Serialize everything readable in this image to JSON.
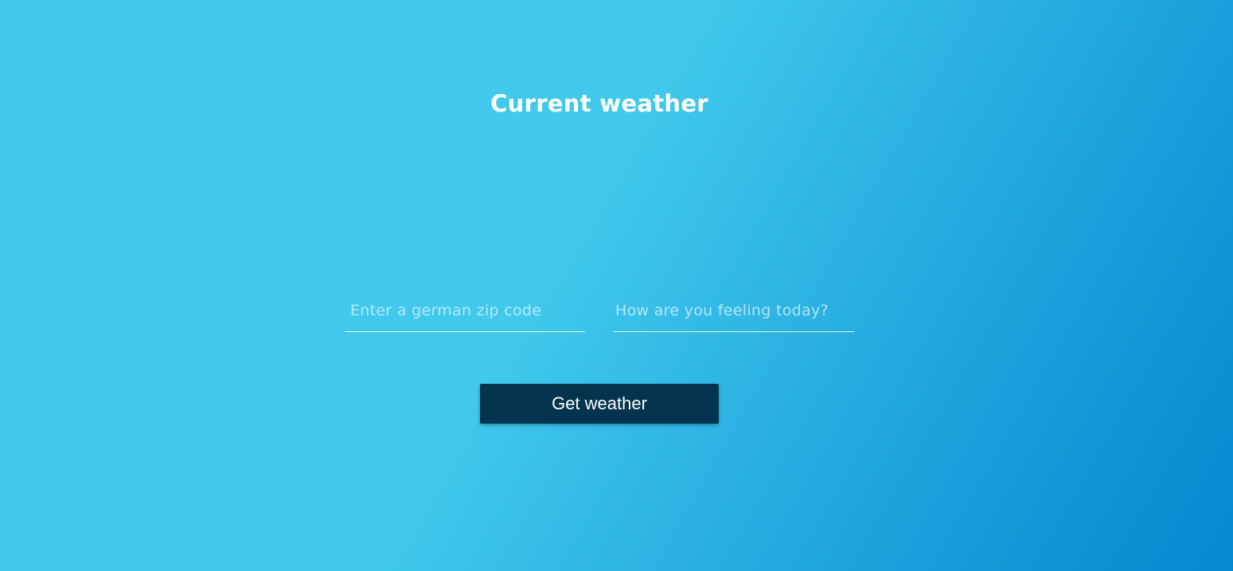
{
  "header": {
    "title": "Current weather"
  },
  "form": {
    "zip": {
      "placeholder": "Enter a german zip code",
      "value": ""
    },
    "feeling": {
      "placeholder": "How are you feeling today?",
      "value": ""
    },
    "submit_label": "Get weather"
  },
  "colors": {
    "background_start": "#40c9ec",
    "background_end": "#0389cf",
    "button": "#04344d",
    "text": "#ffffff"
  }
}
